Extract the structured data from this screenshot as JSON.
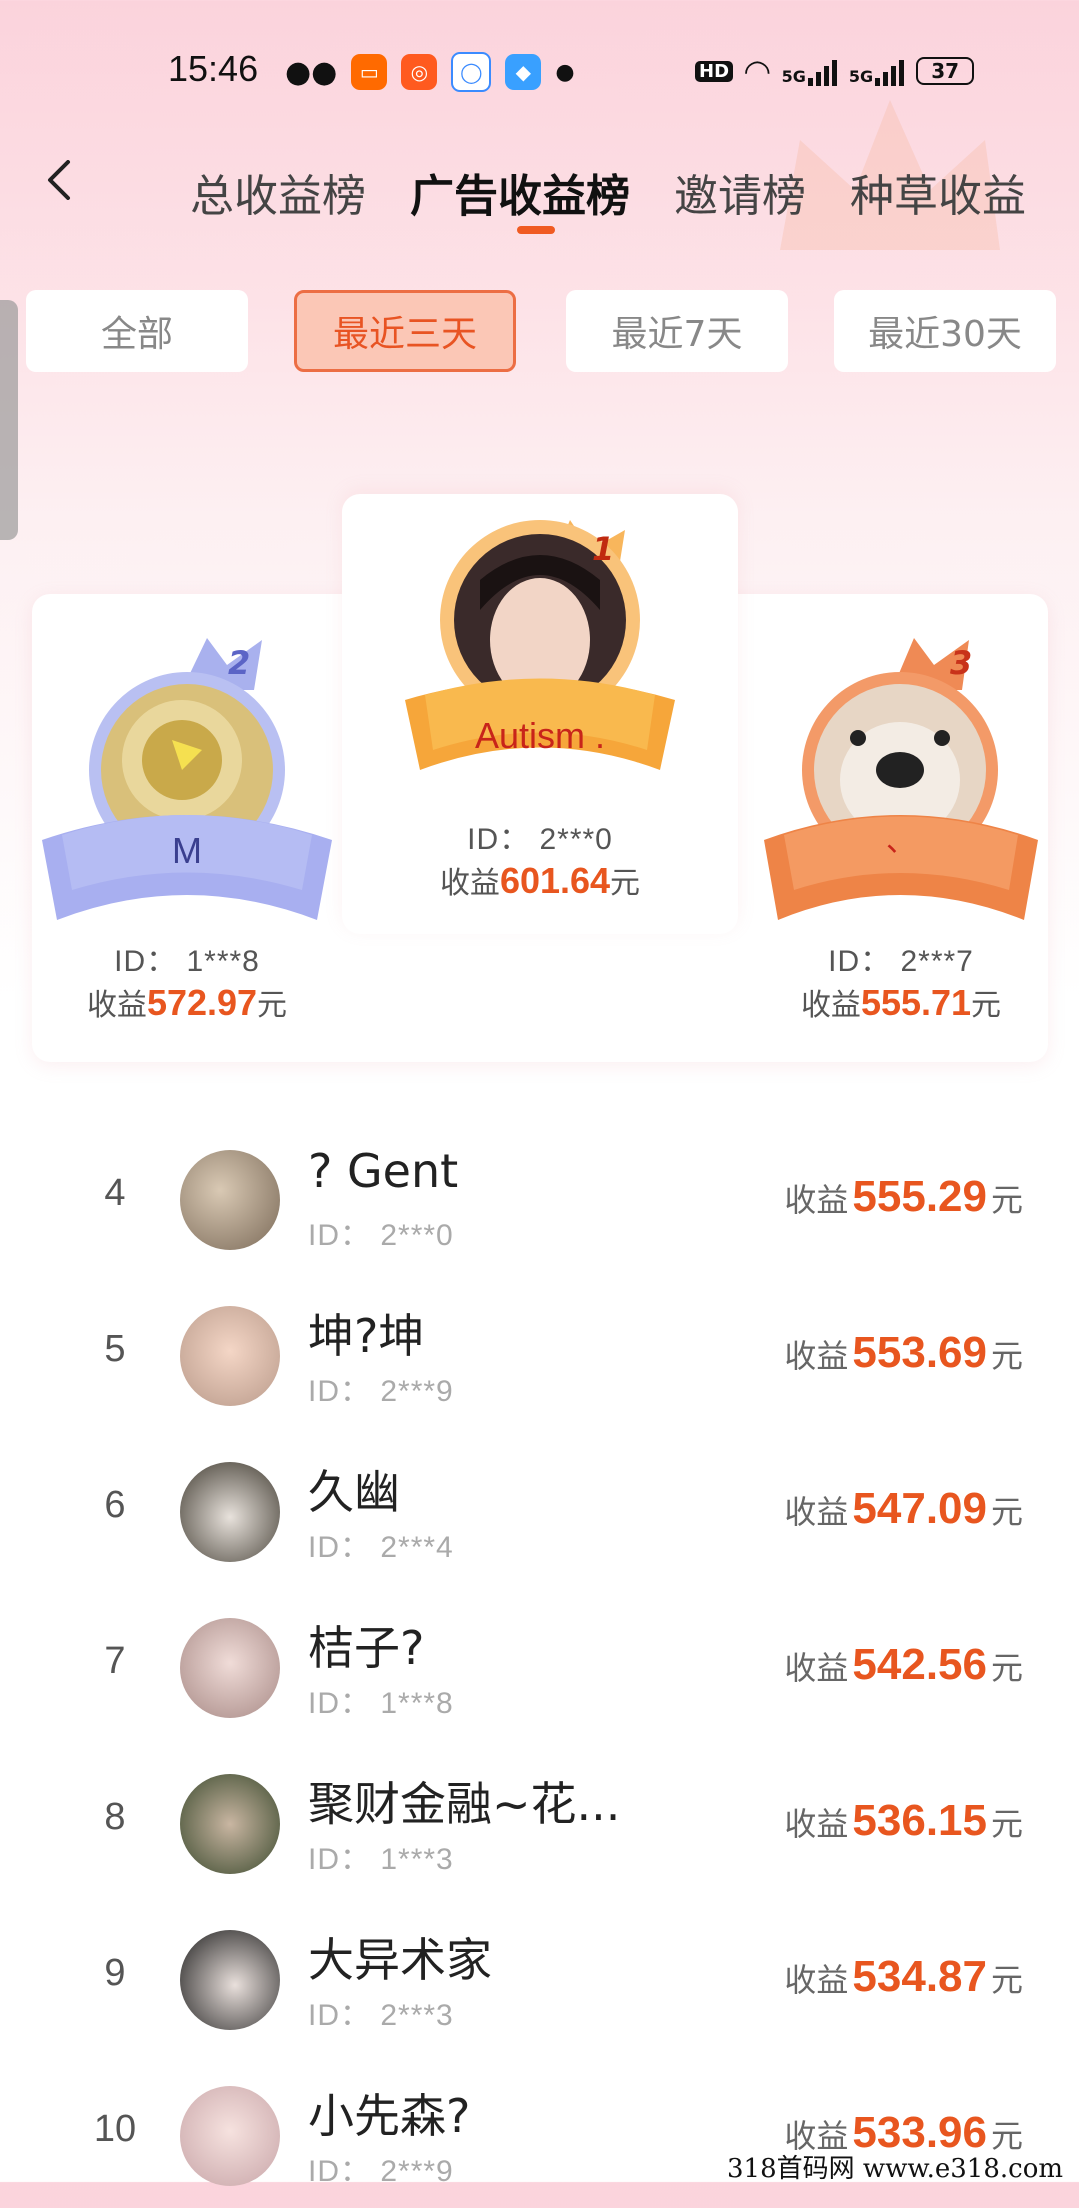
{
  "status": {
    "time": "15:46",
    "hd": "HD",
    "net1": "5G",
    "net2": "5G",
    "battery": "37"
  },
  "tabs": [
    "总收益榜",
    "广告收益榜",
    "邀请榜",
    "种草收益"
  ],
  "filters": [
    "全部",
    "最近三天",
    "最近7天",
    "最近30天"
  ],
  "podium": [
    {
      "rank": "1",
      "name": "Autism .",
      "id": "ID：  2***0",
      "earn_label": "收益",
      "amount": "601.64",
      "unit": "元"
    },
    {
      "rank": "2",
      "name": "M",
      "id": "ID：  1***8",
      "earn_label": "收益",
      "amount": "572.97",
      "unit": "元"
    },
    {
      "rank": "3",
      "name": "、",
      "id": "ID：  2***7",
      "earn_label": "收益",
      "amount": "555.71",
      "unit": "元"
    }
  ],
  "list": [
    {
      "rank": "4",
      "name": "? Gent",
      "id": "ID：  2***0",
      "earn_label": "收益",
      "amount": "555.29",
      "unit": "元"
    },
    {
      "rank": "5",
      "name": "坤?坤",
      "id": "ID：  2***9",
      "earn_label": "收益",
      "amount": "553.69",
      "unit": "元"
    },
    {
      "rank": "6",
      "name": "久幽",
      "id": "ID：  2***4",
      "earn_label": "收益",
      "amount": "547.09",
      "unit": "元"
    },
    {
      "rank": "7",
      "name": "桔子?",
      "id": "ID：  1***8",
      "earn_label": "收益",
      "amount": "542.56",
      "unit": "元"
    },
    {
      "rank": "8",
      "name": "聚财金融~花...",
      "id": "ID：  1***3",
      "earn_label": "收益",
      "amount": "536.15",
      "unit": "元"
    },
    {
      "rank": "9",
      "name": "大异术家",
      "id": "ID：  2***3",
      "earn_label": "收益",
      "amount": "534.87",
      "unit": "元"
    },
    {
      "rank": "10",
      "name": "小先森?",
      "id": "ID：  2***9",
      "earn_label": "收益",
      "amount": "533.96",
      "unit": "元"
    }
  ],
  "watermark": "318首码网   www.e318.com",
  "colors": {
    "accent": "#e8561f",
    "gold": "#f6b04a",
    "silver": "#9ea6ec",
    "bronze": "#ef8a55"
  }
}
